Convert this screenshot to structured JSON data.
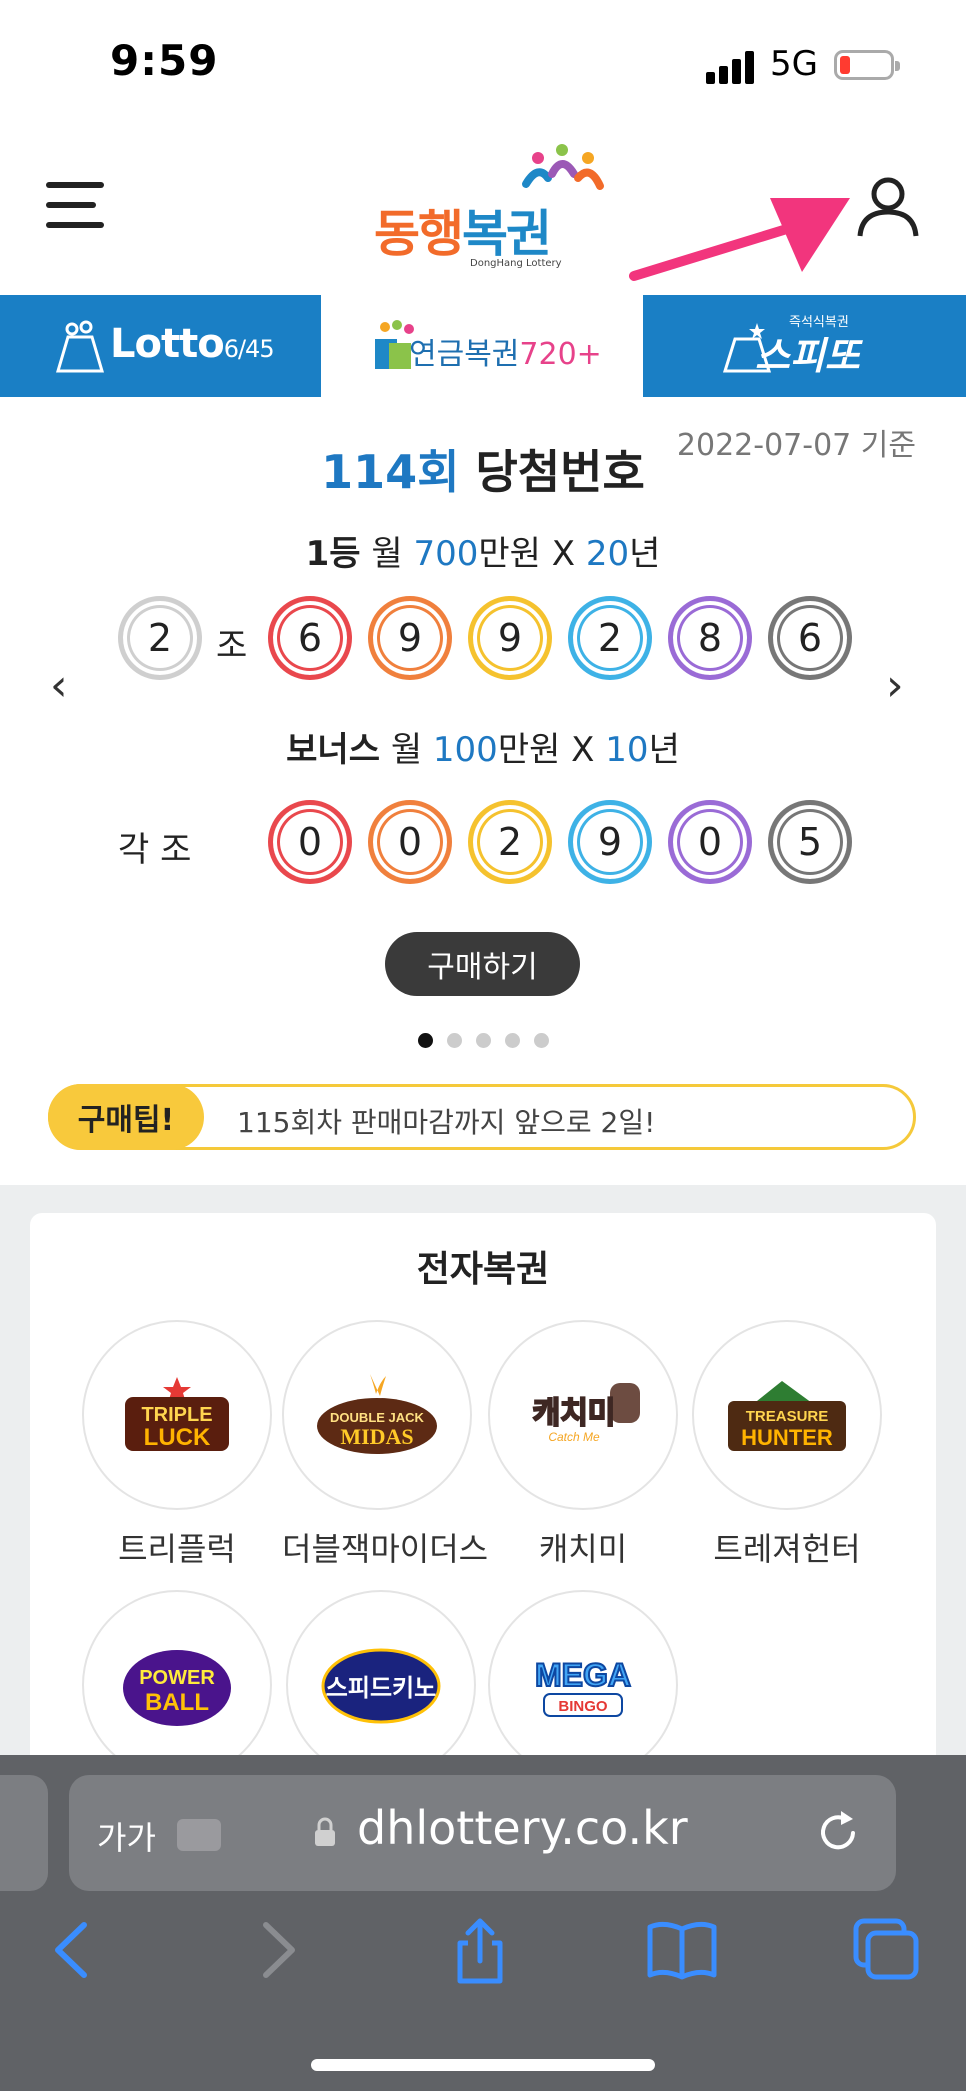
{
  "status_bar": {
    "time": "9:59",
    "network": "5G"
  },
  "header": {
    "logo_text_1": "동행",
    "logo_text_2": "복권",
    "logo_sub": "DongHang Lottery"
  },
  "tabs": [
    {
      "label": "Lotto",
      "suffix": "6/45"
    },
    {
      "label": "연금복권",
      "suffix": "720+"
    },
    {
      "label": "스피또",
      "sub": "즉석식복권"
    }
  ],
  "draw": {
    "date": "2022-07-07 기준",
    "round": "114회",
    "title": "당첨번호",
    "first": {
      "rank": "1등",
      "monthly": "월",
      "amount": "700",
      "unit": "만원 X",
      "years": "20",
      "years_unit": "년",
      "group": "2",
      "group_label": "조",
      "numbers": [
        "6",
        "9",
        "9",
        "2",
        "8",
        "6"
      ]
    },
    "bonus": {
      "rank": "보너스",
      "monthly": "월",
      "amount": "100",
      "unit": "만원 X",
      "years": "10",
      "years_unit": "년",
      "group_label": "각 조",
      "numbers": [
        "0",
        "0",
        "2",
        "9",
        "0",
        "5"
      ]
    },
    "buy_button": "구매하기",
    "prev": "‹",
    "next": "›"
  },
  "ball_colors": [
    "#e9484d",
    "#f0803d",
    "#f5c22e",
    "#3eb2e6",
    "#9a6bd6",
    "#777777"
  ],
  "tip": {
    "label": "구매팁!",
    "text": "115회차 판매마감까지 앞으로 2일!"
  },
  "e_lottery": {
    "title": "전자복권",
    "games": [
      {
        "name": "트리플럭",
        "logo": "TRIPLE LUCK"
      },
      {
        "name": "더블잭마이더스",
        "logo": "DOUBLE JACK MIDAS"
      },
      {
        "name": "캐치미",
        "logo": "캐치미"
      },
      {
        "name": "트레져헌터",
        "logo": "TREASURE HUNTER"
      },
      {
        "name": "",
        "logo": "POWER BALL"
      },
      {
        "name": "",
        "logo": "스피드키노"
      },
      {
        "name": "",
        "logo": "MEGA BINGO"
      }
    ]
  },
  "browser": {
    "text_size": "가가",
    "url": "dhlottery.co.kr"
  }
}
